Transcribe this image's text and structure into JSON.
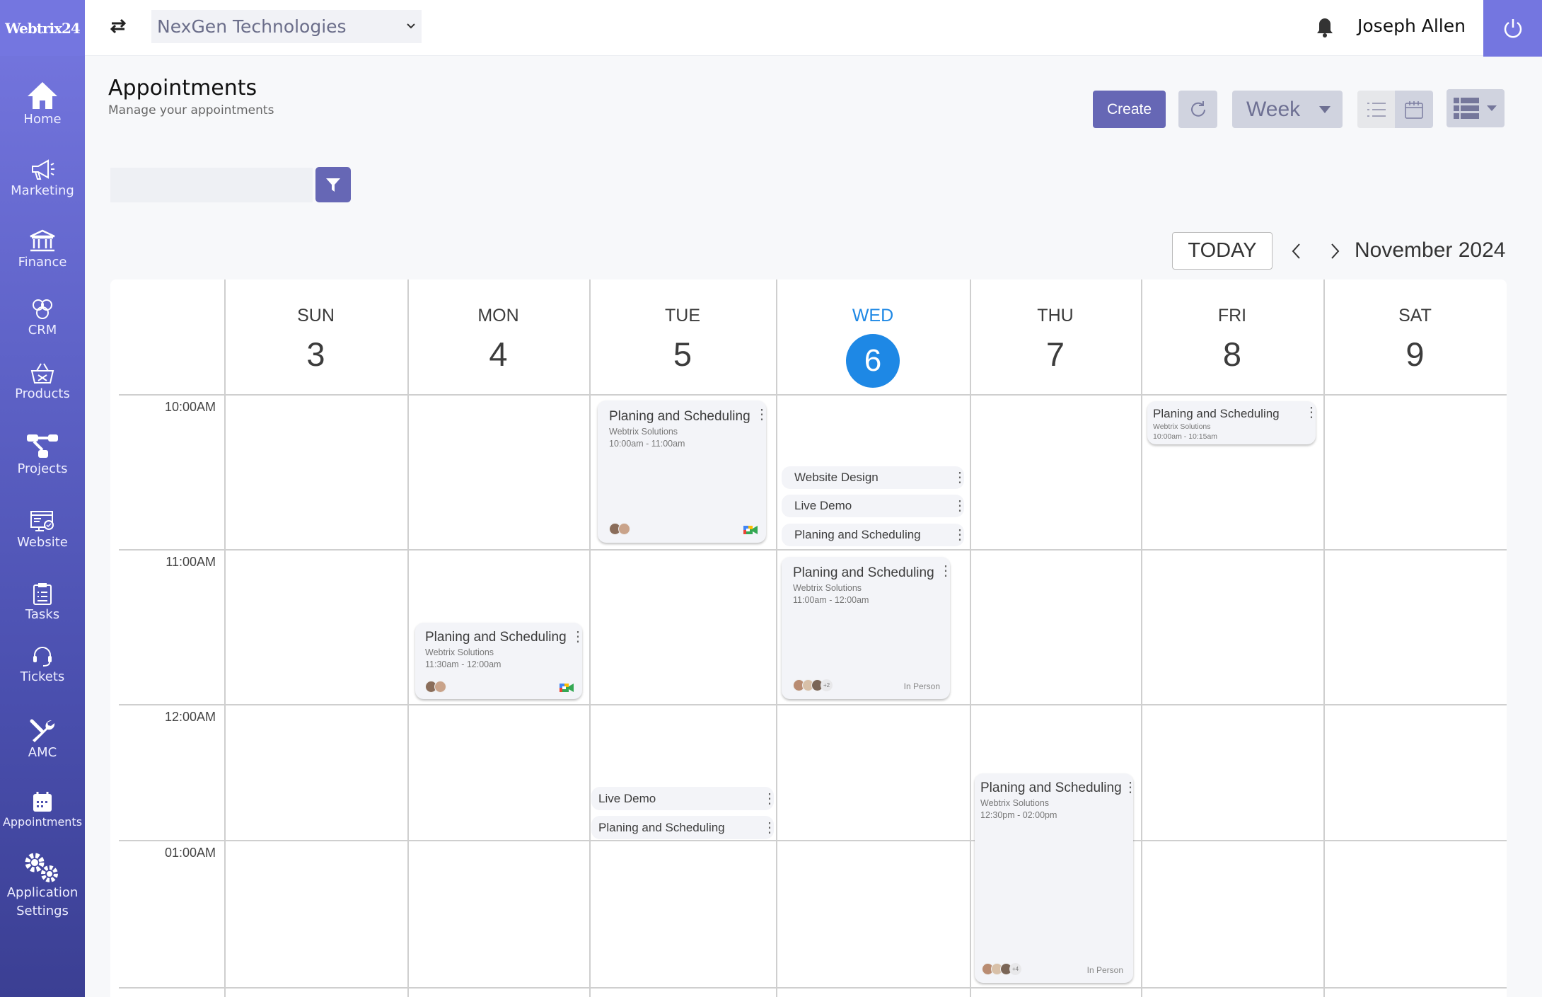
{
  "brand": {
    "logo_text": "Webtrix24",
    "accent": "#7476e0",
    "primary_button": "#6667b5",
    "today_color": "#1e88e5"
  },
  "sidebar": {
    "items": [
      {
        "label": "Home",
        "icon": "home-icon"
      },
      {
        "label": "Marketing",
        "icon": "megaphone-icon"
      },
      {
        "label": "Finance",
        "icon": "bank-icon"
      },
      {
        "label": "CRM",
        "icon": "people-icon"
      },
      {
        "label": "Products",
        "icon": "basket-icon"
      },
      {
        "label": "Projects",
        "icon": "project-icon"
      },
      {
        "label": "Website",
        "icon": "website-icon"
      },
      {
        "label": "Tasks",
        "icon": "clipboard-icon"
      },
      {
        "label": "Tickets",
        "icon": "headset-icon"
      },
      {
        "label": "AMC",
        "icon": "tools-icon"
      },
      {
        "label": "Appointments",
        "icon": "calendar-icon"
      },
      {
        "label": "Application",
        "label2": "Settings",
        "icon": "gears-icon"
      }
    ]
  },
  "header": {
    "company": "NexGen Technologies",
    "user": "Joseph Allen"
  },
  "page": {
    "title": "Appointments",
    "subtitle": "Manage your appointments"
  },
  "toolbar": {
    "create": "Create",
    "view": "Week",
    "search_placeholder": ""
  },
  "nav": {
    "today": "TODAY",
    "month": "November 2024"
  },
  "days": [
    {
      "name": "SUN",
      "num": "3"
    },
    {
      "name": "MON",
      "num": "4"
    },
    {
      "name": "TUE",
      "num": "5"
    },
    {
      "name": "WED",
      "num": "6",
      "today": true
    },
    {
      "name": "THU",
      "num": "7"
    },
    {
      "name": "FRI",
      "num": "8"
    },
    {
      "name": "SAT",
      "num": "9"
    }
  ],
  "times": [
    "10:00AM",
    "11:00AM",
    "12:00AM",
    "01:00AM"
  ],
  "events": {
    "tue_card": {
      "title": "Planing and Scheduling",
      "org": "Webtrix Solutions",
      "time": "10:00am - 11:00am",
      "meeting": "google-meet"
    },
    "wed_list": [
      "Website Design",
      "Live Demo",
      "Planing and Scheduling"
    ],
    "wed_card": {
      "title": "Planing and Scheduling",
      "org": "Webtrix Solutions",
      "time": "11:00am -  12:00am",
      "more": "+2",
      "location": "In Person"
    },
    "fri_card": {
      "title": "Planing and Scheduling",
      "org": "Webtrix Solutions",
      "time": "10:00am - 10:15am"
    },
    "mon_card": {
      "title": "Planing and Scheduling",
      "org": "Webtrix Solutions",
      "time": "11:30am - 12:00am",
      "meeting": "google-meet"
    },
    "tue_list": [
      "Live Demo",
      "Planing and Scheduling"
    ],
    "thu_card": {
      "title": "Planing and Scheduling",
      "org": "Webtrix Solutions",
      "time": "12:30pm - 02:00pm",
      "more": "+4",
      "location": "In Person"
    }
  }
}
